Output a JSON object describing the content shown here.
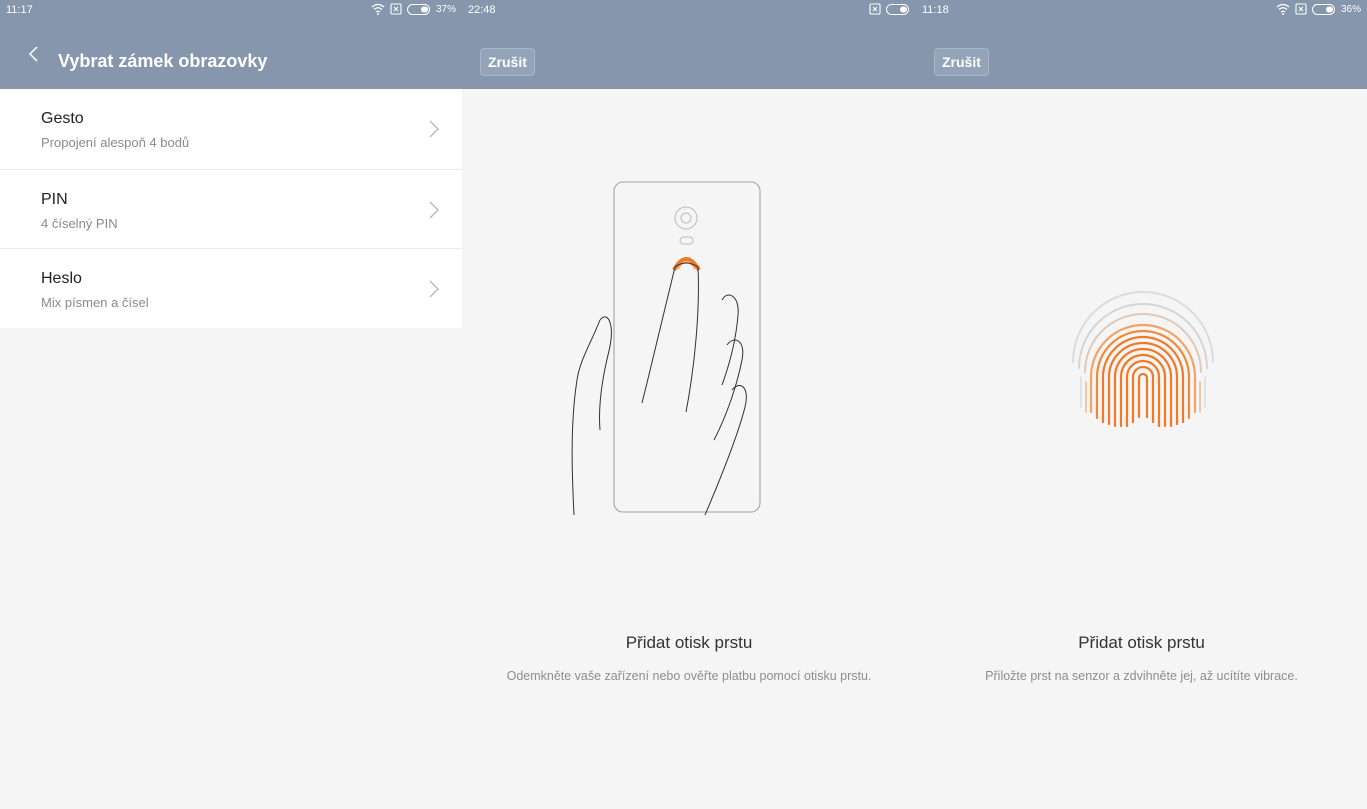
{
  "panels": [
    {
      "status": {
        "time": "11:17",
        "battery_pct": "37%"
      },
      "header": {
        "title": "Vybrat zámek obrazovky"
      },
      "items": [
        {
          "title": "Gesto",
          "subtitle": "Propojení alespoň 4 bodů"
        },
        {
          "title": "PIN",
          "subtitle": "4 číselný PIN"
        },
        {
          "title": "Heslo",
          "subtitle": "Mix písmen a čísel"
        }
      ]
    },
    {
      "status": {
        "time": "22:48"
      },
      "header": {
        "cancel_label": "Zrušit"
      },
      "headline": "Přidat otisk prstu",
      "description": "Odemkněte vaše zařízení nebo ověřte platbu pomocí otisku prstu."
    },
    {
      "status": {
        "time": "11:18",
        "battery_pct": "36%"
      },
      "header": {
        "cancel_label": "Zrušit"
      },
      "headline": "Přidat otisk prstu",
      "description": "Přiložte prst na senzor a zdvihněte jej, až ucítíte vibrace."
    }
  ],
  "icons": {
    "status": [
      "wifi-icon",
      "no-sim-icon",
      "battery-icon"
    ],
    "nav": [
      "back-arrow-icon",
      "chevron-right-icon"
    ],
    "illustrations": [
      "hand-phone-illustration",
      "fingerprint-illustration"
    ]
  },
  "colors": {
    "header": "#8596ad",
    "accent": "#f07a28",
    "background": "#f5f5f5"
  }
}
